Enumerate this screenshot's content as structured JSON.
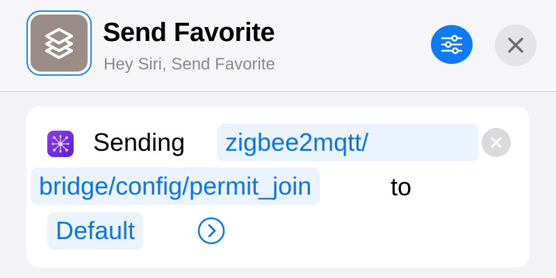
{
  "header": {
    "title": "Send Favorite",
    "subtitle": "Hey Siri, Send Favorite",
    "app_icon": "shortcuts-icon",
    "settings_icon": "sliders-icon",
    "close_icon": "close-icon"
  },
  "action": {
    "icon": "zigbee-network-icon",
    "verb": "Sending",
    "topic_part1": "zigbee2mqtt/",
    "topic_part2": "bridge/config/permit_join",
    "connector": "to",
    "value": "Default",
    "clear_icon": "clear-icon",
    "expand_icon": "chevron-right-circle-icon"
  },
  "colors": {
    "accent": "#0a74ec",
    "token_bg": "#eaf3fe",
    "app_icon_bg": "#9a8d89",
    "action_icon_bg": "#7b34e8"
  }
}
